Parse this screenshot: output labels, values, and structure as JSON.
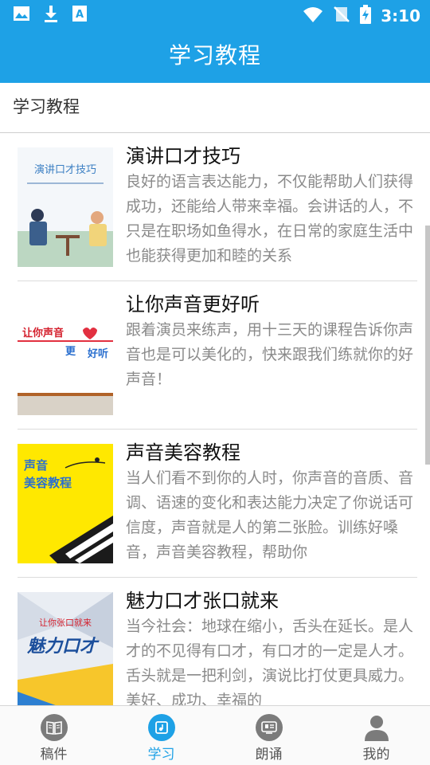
{
  "status_bar": {
    "time": "3:10",
    "left_icons": [
      "image-icon",
      "download-icon",
      "a-icon"
    ],
    "right_icons": [
      "wifi-icon",
      "no-signal-icon",
      "battery-charging-icon"
    ]
  },
  "app_bar": {
    "title": "学习教程"
  },
  "section": {
    "title": "学习教程"
  },
  "courses": [
    {
      "title": "演讲口才技巧",
      "description": "良好的语言表达能力，不仅能帮助人们获得成功，还能给人带来幸福。会讲话的人，不只是在职场如鱼得水，在日常的家庭生活中也能获得更加和睦的关系",
      "thumb_text": "演讲口才技巧"
    },
    {
      "title": "让你声音更好听",
      "description": "跟着演员来练声，用十三天的课程告诉你声音也是可以美化的，快来跟我们练就你的好声音！",
      "thumb_text": "让你声音",
      "thumb_text2": "更",
      "thumb_text3": "好听"
    },
    {
      "title": "声音美容教程",
      "description": "当人们看不到你的人时，你声音的音质、音调、语速的变化和表达能力决定了你说话可信度，声音就是人的第二张脸。训练好嗓音，声音美容教程，帮助你",
      "thumb_text": "声音",
      "thumb_text2": "美容教程"
    },
    {
      "title": "魅力口才张口就来",
      "description": "当今社会：地球在缩小，舌头在延长。是人才的不见得有口才，有口才的一定是人才。 舌头就是一把利剑，演说比打仗更具威力。美好、成功、幸福的",
      "thumb_text": "让你张口就来",
      "thumb_text2": "魅力口才"
    }
  ],
  "bottom_nav": [
    {
      "label": "稿件",
      "icon": "book-icon",
      "active": false
    },
    {
      "label": "学习",
      "icon": "study-icon",
      "active": true
    },
    {
      "label": "朗诵",
      "icon": "recite-icon",
      "active": false
    },
    {
      "label": "我的",
      "icon": "person-icon",
      "active": false
    }
  ],
  "colors": {
    "primary": "#1ea1e6",
    "inactive_icon": "#7b7b7b",
    "description_text": "#8a8a8a"
  }
}
